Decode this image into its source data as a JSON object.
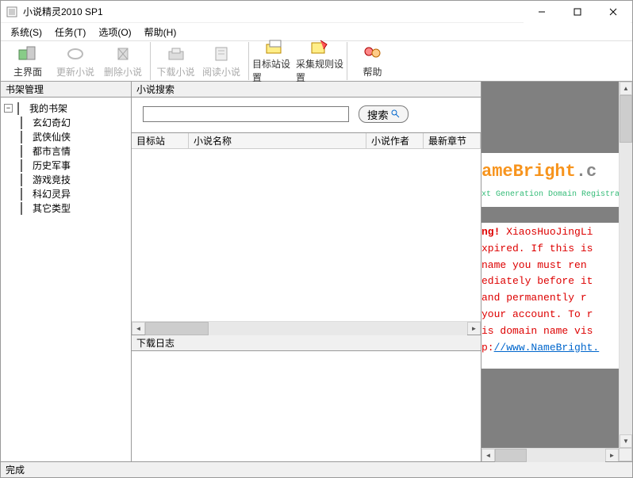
{
  "window": {
    "title": "小说精灵2010 SP1"
  },
  "menubar": {
    "items": [
      {
        "label": "系统(S)"
      },
      {
        "label": "任务(T)"
      },
      {
        "label": "选项(O)"
      },
      {
        "label": "帮助(H)"
      }
    ]
  },
  "toolbar": {
    "buttons": [
      {
        "name": "main-view",
        "label": "主界面",
        "disabled": false
      },
      {
        "name": "refresh-novel",
        "label": "更新小说",
        "disabled": true
      },
      {
        "name": "delete-novel",
        "label": "删除小说",
        "disabled": true
      },
      {
        "name": "download-novel",
        "label": "下载小说",
        "disabled": true
      },
      {
        "name": "read-novel",
        "label": "阅读小说",
        "disabled": true
      },
      {
        "name": "target-settings",
        "label": "目标站设置",
        "disabled": false
      },
      {
        "name": "collect-rule-settings",
        "label": "采集规则设置",
        "disabled": false
      },
      {
        "name": "help",
        "label": "帮助",
        "disabled": false
      }
    ]
  },
  "left": {
    "header": "书架管理",
    "root": "我的书架",
    "categories": [
      "玄幻奇幻",
      "武侠仙侠",
      "都市言情",
      "历史军事",
      "游戏竞技",
      "科幻灵异",
      "其它类型"
    ]
  },
  "center": {
    "search_header": "小说搜索",
    "search_button": "搜索",
    "table_columns": [
      "目标站",
      "小说名称",
      "小说作者",
      "最新章节"
    ],
    "log_header": "下载日志"
  },
  "right": {
    "brand": "ameBright",
    "brand_suffix": ".c",
    "tagline": "xt Generation Domain Registra",
    "warn_strong": "ng!",
    "warn_lines": [
      " XiaosHuoJingLi",
      "xpired. If this is",
      " name you must ren",
      "ediately before it",
      " and permanently r",
      "your account. To r",
      "is domain name vis"
    ],
    "link_prefix": "p:",
    "link": "//www.NameBright."
  },
  "status": {
    "text": "完成"
  }
}
